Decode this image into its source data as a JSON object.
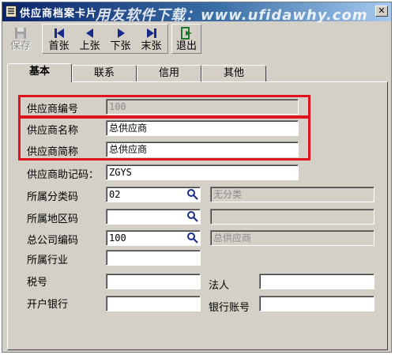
{
  "window": {
    "title": "供应商档案卡片",
    "watermark": "用友软件下载：www.ufidawhy.com"
  },
  "toolbar": {
    "save": "保存",
    "first": "首张",
    "prev": "上张",
    "next": "下张",
    "last": "末张",
    "exit": "退出"
  },
  "tabs": [
    "基本",
    "联系",
    "信用",
    "其他"
  ],
  "form": {
    "code": {
      "label": "供应商编号",
      "value": "100"
    },
    "name": {
      "label": "供应商名称",
      "value": "总供应商"
    },
    "short_name": {
      "label": "供应商简称",
      "value": "总供应商"
    },
    "mnemonic": {
      "label": "供应商助记码：",
      "value": "ZGYS"
    },
    "category": {
      "label": "所属分类码",
      "value": "02",
      "desc": "无分类"
    },
    "region": {
      "label": "所属地区码",
      "value": "",
      "desc": ""
    },
    "head_office": {
      "label": "总公司编码",
      "value": "100",
      "desc": "总供应商"
    },
    "industry": {
      "label": "所属行业",
      "value": ""
    },
    "tax_no": {
      "label": "税号",
      "value": ""
    },
    "legal_rep": {
      "label": "法人",
      "value": ""
    },
    "bank": {
      "label": "开户银行",
      "value": ""
    },
    "bank_account": {
      "label": "银行账号",
      "value": ""
    }
  },
  "colors": {
    "highlight": "#e0141e",
    "titlebar": "#0a246a",
    "nav_arrow": "#1a2a8a",
    "exit_icon": "#1a7a2a"
  }
}
